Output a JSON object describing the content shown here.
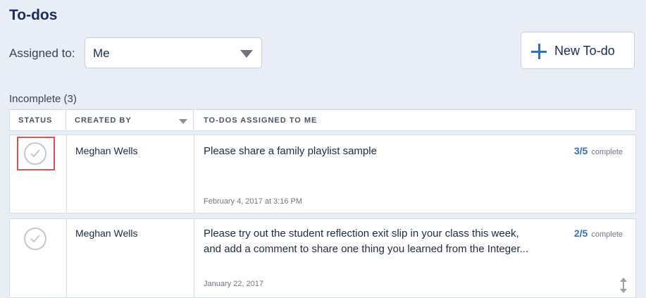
{
  "page": {
    "title": "To-dos"
  },
  "filter": {
    "label": "Assigned to:",
    "selected": "Me"
  },
  "actions": {
    "new_todo_label": "New To-do"
  },
  "section": {
    "label": "Incomplete (3)"
  },
  "table": {
    "headers": {
      "status": "STATUS",
      "created_by": "CREATED BY",
      "todos": "TO-DOS ASSIGNED TO ME"
    },
    "rows": [
      {
        "created_by": "Meghan Wells",
        "text": "Please share a family playlist sample",
        "date": "February 4, 2017 at 3:16 PM",
        "progress": "3/5",
        "progress_label": "complete"
      },
      {
        "created_by": "Meghan Wells",
        "text": "Please try out the student reflection exit slip in your class this week, and add a comment to share one thing you learned from the Integer...",
        "date": "January 22, 2017",
        "progress": "2/5",
        "progress_label": "complete"
      }
    ]
  },
  "colors": {
    "accent": "#2f6fc4",
    "title": "#1b2b5a",
    "highlight": "#e05252",
    "background": "#e9edf5"
  }
}
